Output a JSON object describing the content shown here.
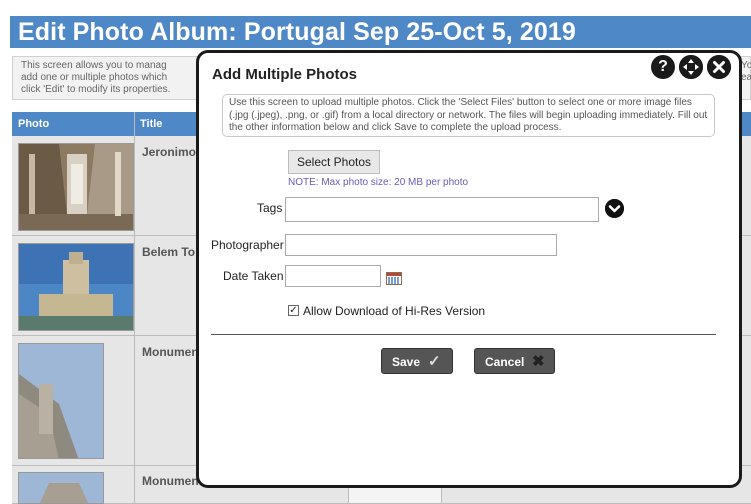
{
  "background": {
    "page_title": "Edit Photo Album: Portugal Sep 25-Oct 5, 2019",
    "info_lines": [
      "This screen allows you to manag",
      "add one or multiple photos which",
      "click 'Edit' to modify its properties."
    ],
    "info_right_lines": [
      "Yo",
      "ea"
    ],
    "columns": [
      "Photo",
      "Title"
    ],
    "rows": [
      {
        "title": "Jeronimo"
      },
      {
        "title": "Belem To"
      },
      {
        "title": "Monumen"
      },
      {
        "title": "Monumen"
      }
    ]
  },
  "modal": {
    "title": "Add Multiple Photos",
    "icons": [
      "help-icon",
      "move-icon",
      "close-icon"
    ],
    "instructions": "Use this screen to upload multiple photos. Click the 'Select Files' button to select one or more image files (.jpg (.jpeg), .png, or .gif) from a local directory or network. The files will begin uploading immediately. Fill out the other information below and click Save to complete the upload process.",
    "select_button": "Select Photos",
    "note": "NOTE: Max photo size: 20 MB per photo",
    "fields": {
      "tags_label": "Tags",
      "tags_value": "",
      "photographer_label": "Photographer",
      "photographer_value": "",
      "date_label": "Date Taken",
      "date_value": ""
    },
    "allow_download": {
      "label": "Allow Download of Hi-Res Version",
      "checked": true
    },
    "save_label": "Save",
    "cancel_label": "Cancel"
  }
}
